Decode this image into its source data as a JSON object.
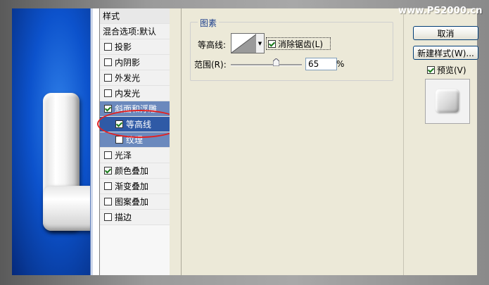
{
  "watermark": "www.PS2000.cn",
  "styles_panel": {
    "header": "样式",
    "blend_options": "混合选项:默认",
    "items": [
      {
        "label": "投影",
        "checked": false
      },
      {
        "label": "内阴影",
        "checked": false
      },
      {
        "label": "外发光",
        "checked": false
      },
      {
        "label": "内发光",
        "checked": false
      },
      {
        "label": "斜面和浮雕",
        "checked": true
      },
      {
        "label": "等高线",
        "checked": true
      },
      {
        "label": "纹理",
        "checked": false
      },
      {
        "label": "光泽",
        "checked": false
      },
      {
        "label": "颜色叠加",
        "checked": true
      },
      {
        "label": "渐变叠加",
        "checked": false
      },
      {
        "label": "图案叠加",
        "checked": false
      },
      {
        "label": "描边",
        "checked": false
      }
    ]
  },
  "contour_panel": {
    "group_title": "图素",
    "contour_label": "等高线:",
    "anti_alias_label": "消除锯齿(L)",
    "anti_alias_checked": true,
    "range_label": "范围(R):",
    "range_value": "65",
    "range_unit": "%"
  },
  "actions": {
    "cancel": "取消",
    "new_style": "新建样式(W)...",
    "preview_label": "预览(V)",
    "preview_checked": true
  }
}
